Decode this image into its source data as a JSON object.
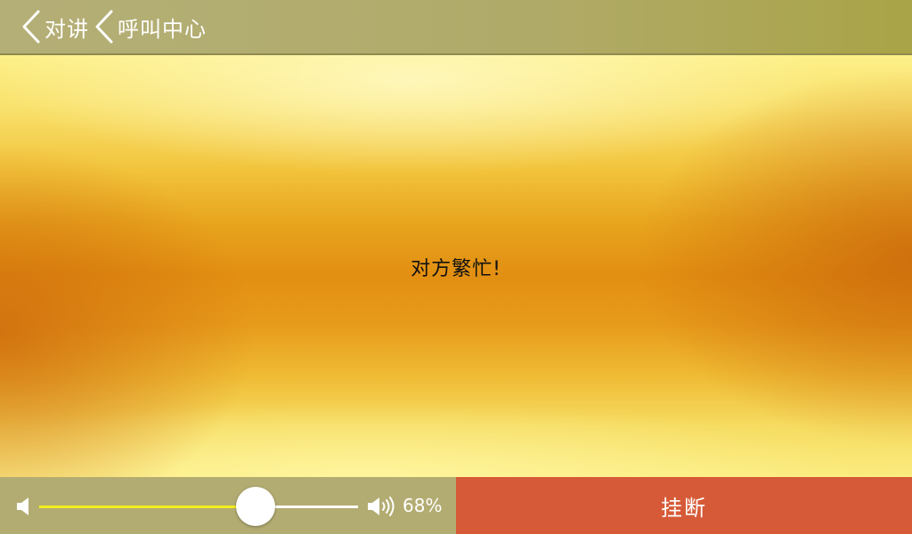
{
  "header": {
    "breadcrumbs": [
      {
        "label": "对讲",
        "icon": "chevron-left-icon"
      },
      {
        "label": "呼叫中心",
        "icon": "chevron-left-icon"
      }
    ]
  },
  "main": {
    "status_text": "对方繁忙!"
  },
  "volume": {
    "percent_label": "68%",
    "level": 0.68,
    "low_icon": "volume-low-icon",
    "high_icon": "volume-high-icon",
    "fill_color": "#f5ed1e"
  },
  "actions": {
    "hangup_label": "挂断",
    "hangup_color": "#d65a37"
  }
}
